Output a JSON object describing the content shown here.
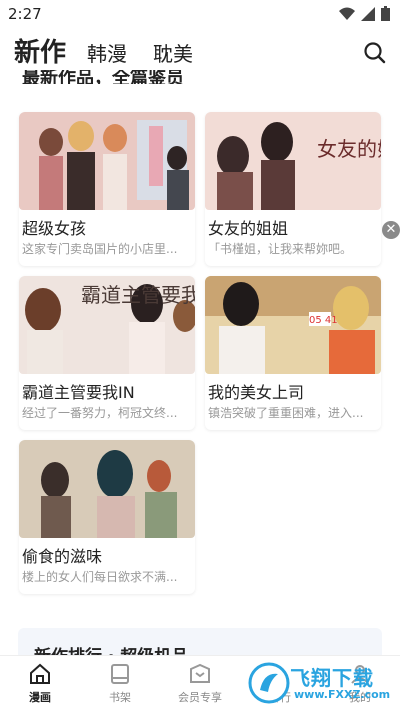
{
  "status": {
    "time": "2:27"
  },
  "header": {
    "tabs": [
      {
        "label": "新作"
      },
      {
        "label": "韩漫"
      },
      {
        "label": "耽美"
      }
    ]
  },
  "section": {
    "title": "最新作品，全篇鉴员"
  },
  "cards": [
    {
      "title": "超级女孩",
      "desc": "这家专门卖岛国片的小店里..."
    },
    {
      "title": "女友的姐姐",
      "desc": "「书槿姐，让我来帮妳吧。",
      "cover_text": "女友的姐姐"
    },
    {
      "title": "霸道主管要我IN",
      "desc": "经过了一番努力，柯冠文终...",
      "cover_text": "霸道主管要我IN"
    },
    {
      "title": "我的美女上司",
      "desc": "镇浩突破了重重困难，进入...",
      "cover_text": "05 41"
    },
    {
      "title": "偷食的滋味",
      "desc": "楼上的女人们每日欲求不满..."
    }
  ],
  "ranking": {
    "title": "新作排行 · 超级机品"
  },
  "bottom_nav": {
    "items": [
      {
        "label": "漫画"
      },
      {
        "label": "书架"
      },
      {
        "label": "会员专享"
      },
      {
        "label": "排行"
      },
      {
        "label": "我的"
      }
    ]
  },
  "watermark": {
    "brand": "飞翔下载",
    "url": "www.FXXZ.com"
  },
  "colors": {
    "accent": "#2aa4e0",
    "text": "#222222",
    "muted": "#999999"
  }
}
